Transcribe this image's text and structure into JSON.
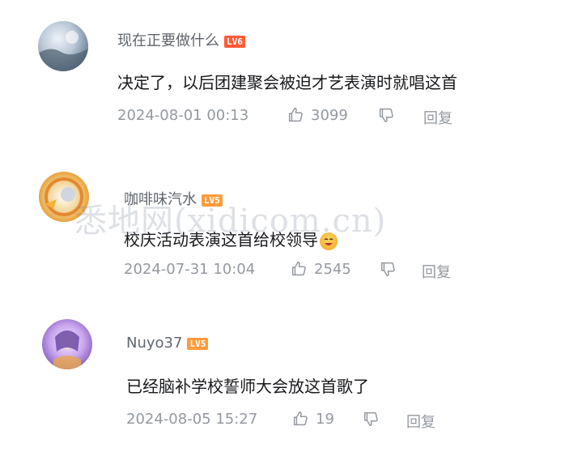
{
  "comments": [
    {
      "username": "现在正要做什么",
      "level": "LV6",
      "text": "决定了，以后团建聚会被迫才艺表演时就唱这首",
      "timestamp": "2024-08-01 00:13",
      "likes": "3099",
      "reply_label": "回复",
      "avatar_icon": "landscape-avatar-icon"
    },
    {
      "username": "咖啡味汽水",
      "level": "LV5",
      "text": "校庆活动表演这首给校领导",
      "timestamp": "2024-07-31 10:04",
      "likes": "2545",
      "reply_label": "回复",
      "avatar_icon": "anime-avatar-icon"
    },
    {
      "username": "Nuyo37",
      "level": "LV5",
      "text": "已经脑补学校誓师大会放这首歌了",
      "timestamp": "2024-08-05 15:27",
      "likes": "19",
      "reply_label": "回复",
      "avatar_icon": "anime-avatar-icon"
    }
  ],
  "watermark": "悉地网(xidicom.cn)",
  "colors": {
    "lv6": "#ff5a36",
    "lv5": "#ff9b3a",
    "meta": "#9499a0",
    "username": "#61666d"
  }
}
